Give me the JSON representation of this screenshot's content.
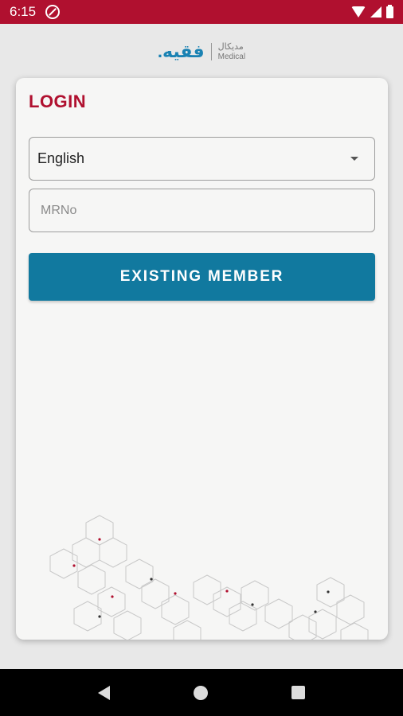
{
  "status_bar": {
    "time": "6:15",
    "icons": [
      "do-not-disturb-icon",
      "wifi-icon",
      "signal-icon",
      "battery-icon"
    ]
  },
  "logo": {
    "main": "فقيه.",
    "sub_arabic": "مديكال",
    "sub_english": "Medical"
  },
  "login": {
    "title": "LOGIN",
    "language": {
      "selected": "English"
    },
    "mrno": {
      "value": "",
      "placeholder": "MRNo"
    },
    "button_label": "EXISTING MEMBER"
  },
  "nav_bar": {
    "icons": [
      "back-icon",
      "home-icon",
      "recents-icon"
    ]
  },
  "colors": {
    "brand_red": "#b0102f",
    "button_blue": "#11799f",
    "logo_blue": "#1a82b3"
  }
}
